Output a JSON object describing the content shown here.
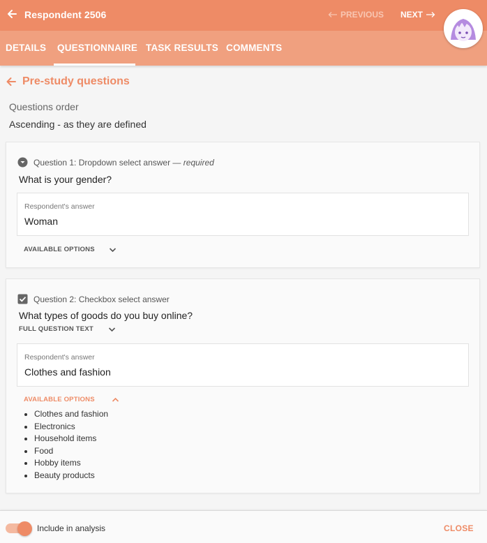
{
  "header": {
    "title": "Respondent 2506",
    "previous_label": "PREVIOUS",
    "next_label": "NEXT",
    "brand_color": "#ee8b66"
  },
  "tabs": [
    {
      "label": "DETAILS",
      "active": false
    },
    {
      "label": "QUESTIONNAIRE",
      "active": true
    },
    {
      "label": "TASK RESULTS",
      "active": false
    },
    {
      "label": "COMMENTS",
      "active": false
    }
  ],
  "section": {
    "title": "Pre-study questions",
    "order_label": "Questions order",
    "order_value": "Ascending - as they are defined"
  },
  "questions": [
    {
      "icon": "dropdown-icon",
      "header": "Question 1: Dropdown select answer —",
      "required_label": "required",
      "text": "What is your gender?",
      "answer_label": "Respondent's answer",
      "answer_value": "Woman",
      "options_toggle": "AVAILABLE OPTIONS",
      "options_expanded": false
    },
    {
      "icon": "checkbox-icon",
      "header": "Question 2: Checkbox select answer",
      "text": "What types of goods do you buy online?",
      "full_text_toggle": "FULL QUESTION TEXT",
      "answer_label": "Respondent's answer",
      "answer_value": "Clothes and fashion",
      "options_toggle": "AVAILABLE OPTIONS",
      "options_expanded": true,
      "options": [
        "Clothes and fashion",
        "Electronics",
        "Household items",
        "Food",
        "Hobby items",
        "Beauty products"
      ]
    }
  ],
  "footer": {
    "include_label": "Include in analysis",
    "include_checked": true,
    "close_label": "CLOSE"
  }
}
